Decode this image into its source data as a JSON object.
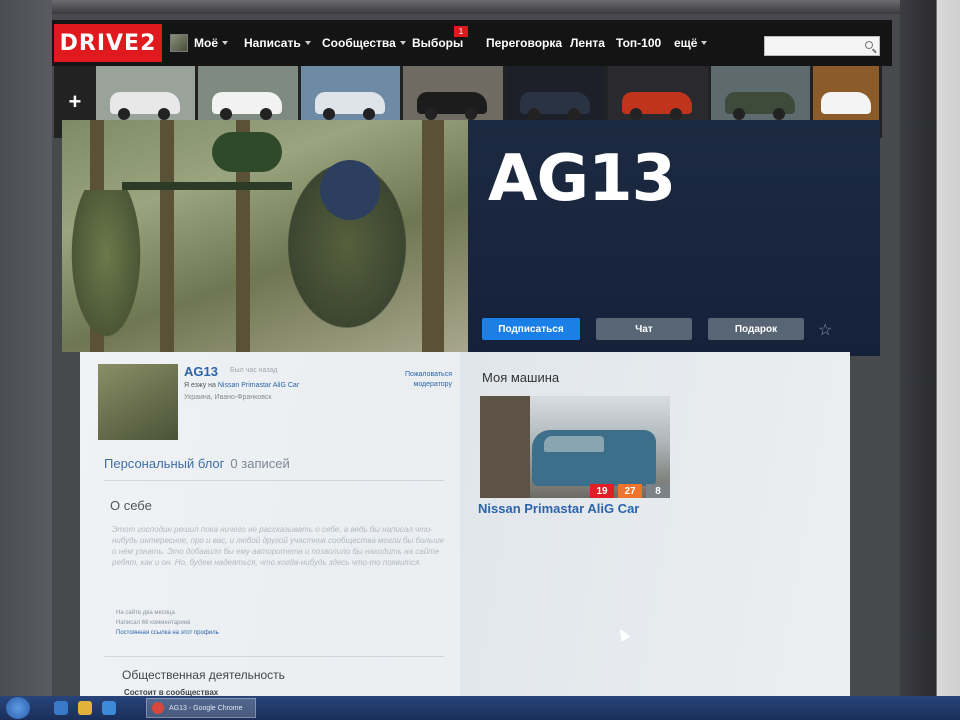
{
  "nav": {
    "logo": "DRIVE2",
    "items": [
      {
        "label": "Моё",
        "caret": true
      },
      {
        "label": "Написать",
        "caret": true
      },
      {
        "label": "Сообщества",
        "caret": true
      },
      {
        "label": "Выборы",
        "caret": false
      },
      {
        "label": "Переговорка",
        "caret": false
      },
      {
        "label": "Лента",
        "caret": false
      },
      {
        "label": "Топ-100",
        "caret": false
      },
      {
        "label": "ещё",
        "caret": true
      }
    ],
    "elections_badge": "1",
    "search_placeholder": ""
  },
  "strip": {
    "add_label": "+",
    "thumb_colors": [
      "#e8e8e8",
      "#f2f2f2",
      "#dfe4ea",
      "#1c1c1c",
      "#2a3344",
      "#c0341e",
      "#3e4a3a",
      "#f4f4f4"
    ]
  },
  "profile": {
    "title": "AG13",
    "subscribe_label": "Подписаться",
    "chat_label": "Чат",
    "gift_label": "Подарок",
    "star_icon": "☆",
    "name": "AG13",
    "last_seen": "Был час назад",
    "drive_prefix": "Я езжу на ",
    "drive_car": "Nissan Primastar AliG Car",
    "location": "Украина, Ивано-Франковск",
    "report_label": "Пожаловаться модератору"
  },
  "blog": {
    "title": "Персональный блог",
    "count": "0 записей"
  },
  "about": {
    "heading": "О себе",
    "text": "Этот господин решил пока ничего не рассказывать о себе, а ведь бы написал что-нибудь интересное, про и вас, и любой другой участник сообщества могли бы больше о нём узнать. Это добавило бы ему авторитета и позволило бы находить на сайте ребят, как и он. Но, будем надеяться, что когда-нибудь здесь что-то появится.",
    "on_site": "На сайте два месяца",
    "comments": "Написал 66 комментариев",
    "permalink": "Постоянная ссылка на этот профиль"
  },
  "social": {
    "heading": "Общественная деятельность",
    "sub": "Состоит в сообществах"
  },
  "my_car": {
    "heading": "Моя машина",
    "name": "Nissan Primastar AliG Car",
    "stat_a": "19",
    "stat_b": "27",
    "stat_c": "8"
  },
  "taskbar": {
    "window_label": "AG13 - Google Chrome"
  }
}
